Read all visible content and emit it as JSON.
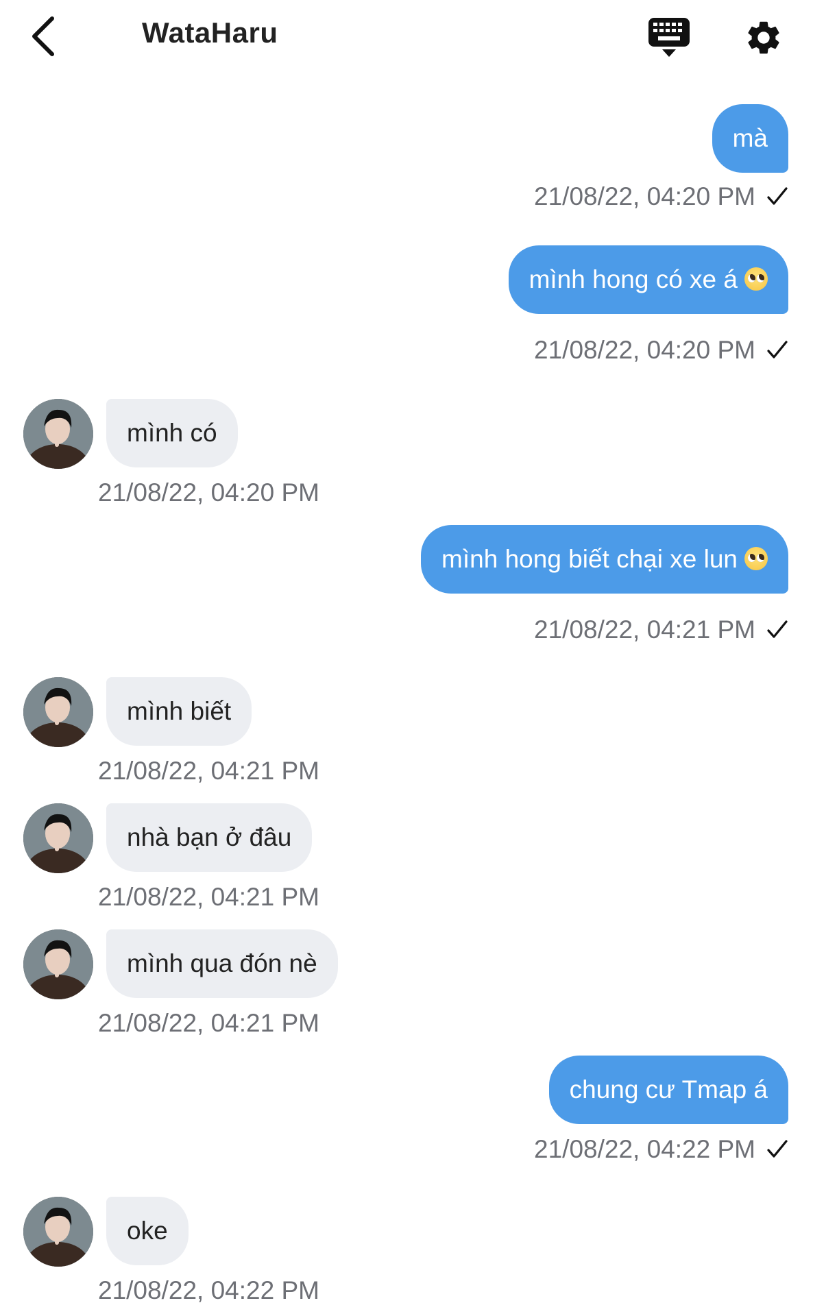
{
  "header": {
    "title": "WataHaru",
    "back_icon": "chevron-left-icon",
    "keyboard_icon": "keyboard-icon",
    "settings_icon": "gear-icon"
  },
  "colors": {
    "outgoing_bubble": "#4c9be8",
    "incoming_bubble": "#eceef2",
    "timestamp": "#6d6f75"
  },
  "messages": [
    {
      "direction": "out",
      "text": "mà",
      "time": "21/08/22, 04:20 PM",
      "status": "sent-check-icon"
    },
    {
      "direction": "out",
      "text": "mình hong có xe á",
      "emoji": "pleading-face",
      "time": "21/08/22, 04:20 PM",
      "status": "sent-check-icon"
    },
    {
      "direction": "in",
      "text": "mình có",
      "time": "21/08/22, 04:20 PM"
    },
    {
      "direction": "out",
      "text": "mình hong biết chại xe lun",
      "emoji": "pleading-face",
      "time": "21/08/22, 04:21 PM",
      "status": "sent-check-icon"
    },
    {
      "direction": "in",
      "text": "mình biết",
      "time": "21/08/22, 04:21 PM"
    },
    {
      "direction": "in",
      "text": "nhà bạn ở đâu",
      "time": "21/08/22, 04:21 PM"
    },
    {
      "direction": "in",
      "text": "mình qua đón nè",
      "time": "21/08/22, 04:21 PM"
    },
    {
      "direction": "out",
      "text": "chung cư Tmap á",
      "time": "21/08/22, 04:22 PM",
      "status": "sent-check-icon"
    },
    {
      "direction": "in",
      "text": "oke",
      "time": "21/08/22, 04:22 PM"
    }
  ]
}
